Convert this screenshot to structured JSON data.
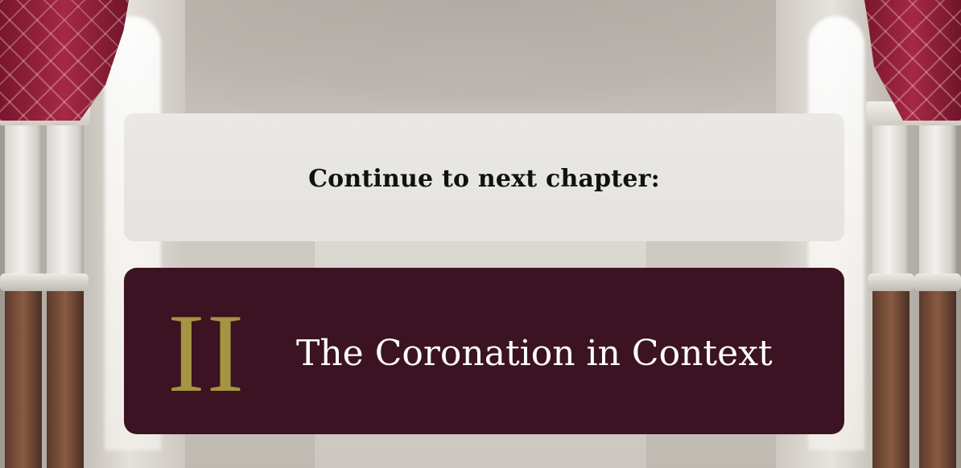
{
  "prompt": {
    "label": "Continue to next chapter:"
  },
  "next_chapter": {
    "numeral": "II",
    "title": "The Coronation in Context"
  },
  "colors": {
    "chapter_card_bg": "#3c1322",
    "numeral_gold": "#a59441",
    "prompt_card_bg": "#e7e5e2",
    "curtain_red": "#a11d3c"
  }
}
